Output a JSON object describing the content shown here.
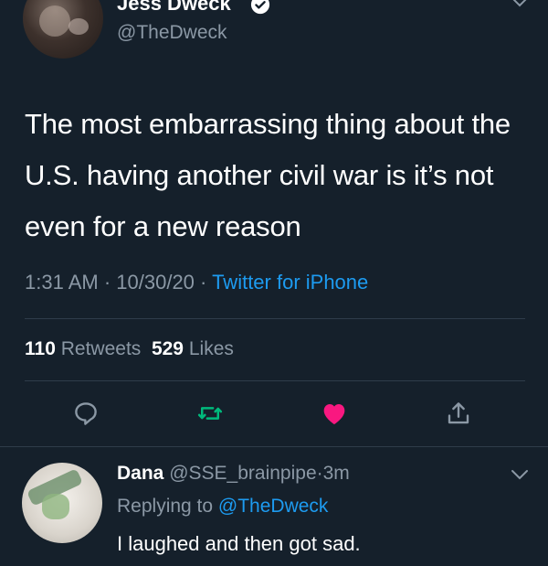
{
  "tweet": {
    "author_name": "Jess Dweck",
    "author_handle": "@TheDweck",
    "text": "The most embarrassing thing about the U.S. having another civil war is it’s not even for a new reason",
    "time": "1:31 AM",
    "date": "10/30/20",
    "separator": " · ",
    "source": "Twitter for iPhone",
    "retweets_count": "110",
    "retweets_label": "Retweets",
    "likes_count": "529",
    "likes_label": "Likes"
  },
  "icons": {
    "verified": "verified-badge-icon",
    "reply": "reply-icon",
    "retweet": "retweet-icon",
    "like": "heart-icon",
    "share": "share-icon",
    "more": "chevron-down-icon"
  },
  "colors": {
    "background": "#15202b",
    "link": "#1d9bf0",
    "retweet": "#00ba7c",
    "like": "#f91880",
    "muted": "#8b98a5"
  },
  "reply": {
    "name": "Dana",
    "handle": "@SSE_brainpipe",
    "age": "3m",
    "replying_prefix": "Replying to",
    "replying_to": "@TheDweck",
    "text": "I laughed and then got sad."
  }
}
